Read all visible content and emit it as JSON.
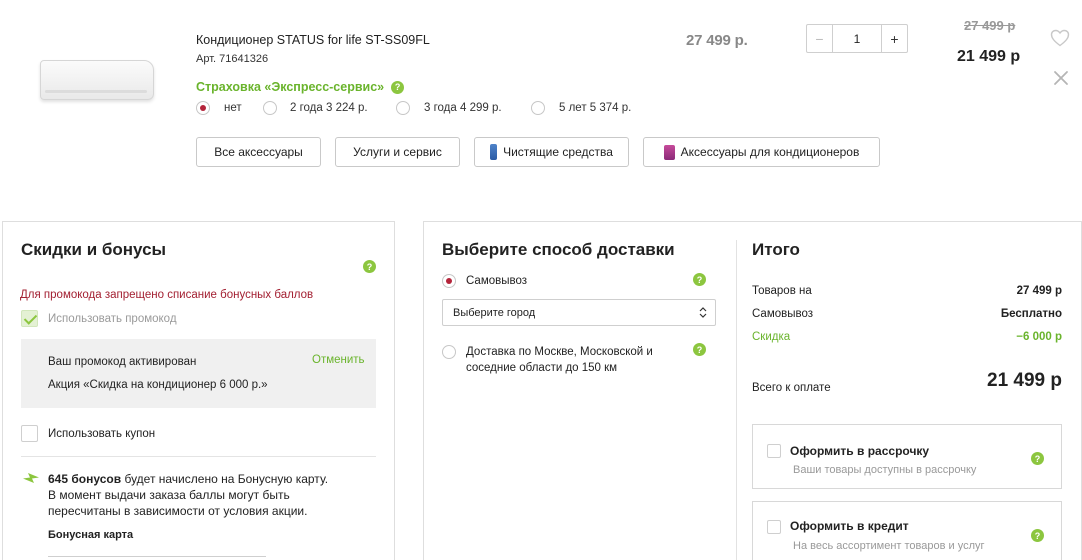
{
  "product": {
    "name": "Кондиционер STATUS for life ST-SS09FL",
    "sku": "Арт. 71641326",
    "price": "27 499 р.",
    "quantity": "1",
    "qty_minus": "−",
    "qty_plus": "+",
    "old_price": "27 499 р",
    "new_price": "21 499 р",
    "insurance": {
      "title": "Страховка «Экспресс-сервис»",
      "options": [
        {
          "label": "нет",
          "selected": true
        },
        {
          "label": "2 года 3 224 р.",
          "selected": false
        },
        {
          "label": "3 года 4 299 р.",
          "selected": false
        },
        {
          "label": "5 лет 5 374 р.",
          "selected": false
        }
      ]
    },
    "accessory_buttons": [
      "Все аксессуары",
      "Услуги и сервис",
      "Чистящие средства",
      "Аксессуары для кондиционеров"
    ]
  },
  "discounts": {
    "title": "Скидки и бонусы",
    "warning": "Для промокода запрещено списание бонусных баллов",
    "use_promo_label": "Использовать промокод",
    "promo_activated": "Ваш промокод активирован",
    "promo_cancel": "Отменить",
    "promo_action": "Акция «Скидка на кондиционер 6 000 р.»",
    "use_coupon_label": "Использовать купон",
    "bonus_amount": "645 бонусов",
    "bonus_text_1": "будет начислено на Бонусную карту.",
    "bonus_text_2": "В момент выдачи заказа баллы могут быть",
    "bonus_text_3": "пересчитаны в зависимости от условия акции.",
    "bonus_card_label": "Бонусная карта"
  },
  "delivery": {
    "title": "Выберите способ доставки",
    "pickup_label": "Самовывоз",
    "city_select": "Выберите город",
    "courier_label_1": "Доставка по Москве, Московской и",
    "courier_label_2": "соседние области до 150 км"
  },
  "summary": {
    "title": "Итого",
    "goods_label": "Товаров на",
    "goods_value": "27 499 р",
    "pickup_label": "Самовывоз",
    "pickup_value": "Бесплатно",
    "discount_label": "Скидка",
    "discount_value": "−6 000 р",
    "total_label": "Всего к оплате",
    "total_value": "21 499 р",
    "installment_title": "Оформить в рассрочку",
    "installment_sub": "Ваши товары доступны в рассрочку",
    "credit_title": "Оформить в кредит",
    "credit_sub": "На весь ассортимент товаров и услуг"
  },
  "icons": {
    "help": "?",
    "heart": "heart-icon",
    "close": "close-icon",
    "bonus": "lightning-icon",
    "select": "updown-arrows-icon"
  },
  "colors": {
    "accent_green": "#8cc63f",
    "brand_red": "#b4243a",
    "warning_red": "#a32032"
  }
}
